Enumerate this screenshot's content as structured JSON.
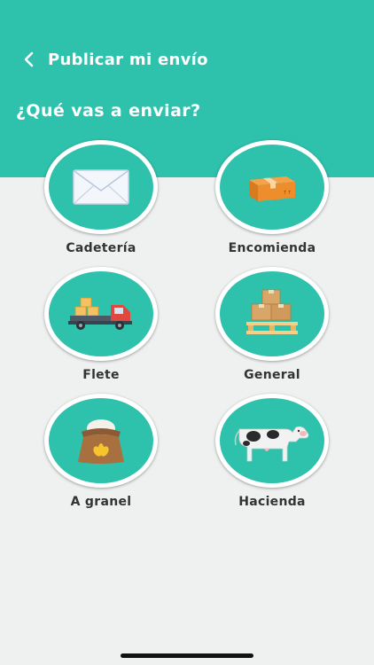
{
  "nav": {
    "title": "Publicar mi envío"
  },
  "question": "¿Qué vas a enviar?",
  "options": [
    {
      "label": "Cadetería",
      "icon": "envelope-icon"
    },
    {
      "label": "Encomienda",
      "icon": "package-box-icon"
    },
    {
      "label": "Flete",
      "icon": "delivery-truck-icon"
    },
    {
      "label": "General",
      "icon": "boxes-on-pallet-icon"
    },
    {
      "label": "A granel",
      "icon": "grain-sack-icon"
    },
    {
      "label": "Hacienda",
      "icon": "cow-icon"
    }
  ],
  "colors": {
    "primary": "#2ec1ac",
    "background": "#eff1f1",
    "text": "#333333"
  }
}
